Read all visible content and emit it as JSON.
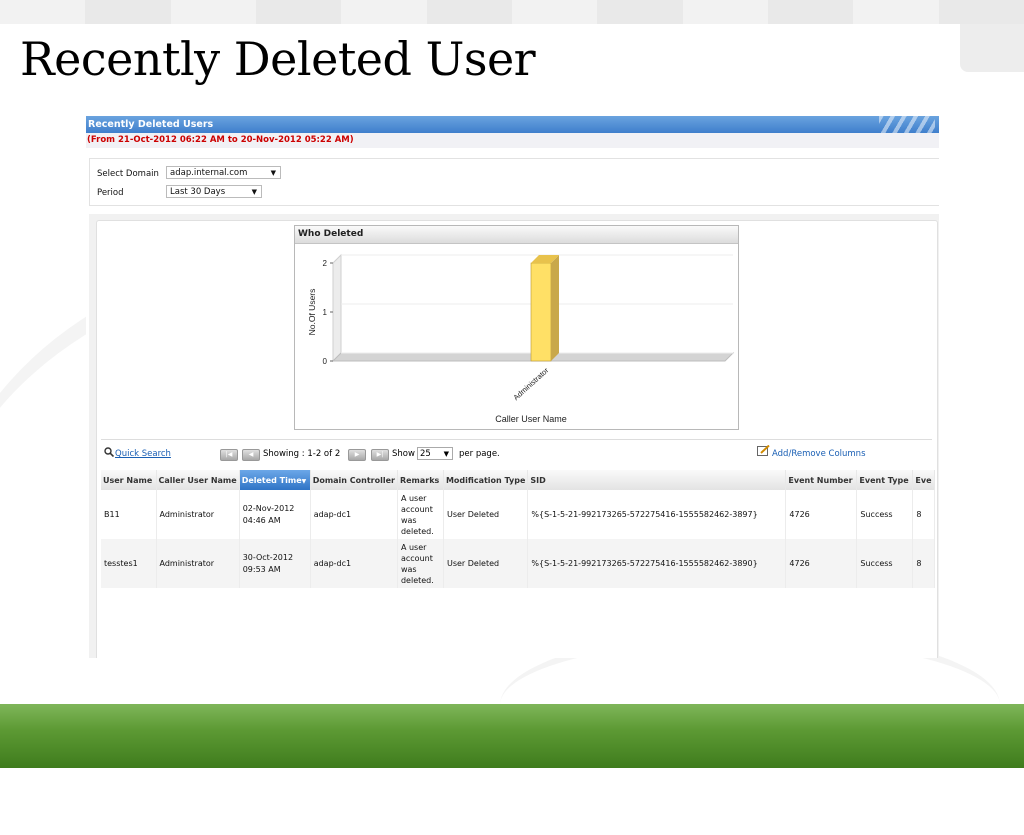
{
  "slide": {
    "title": "Recently Deleted User"
  },
  "report": {
    "header": "Recently Deleted Users",
    "date_range": "(From 21-Oct-2012 06:22 AM to 20-Nov-2012 05:22 AM)"
  },
  "filters": {
    "domain_label": "Select Domain",
    "domain_value": "adap.internal.com",
    "period_label": "Period",
    "period_value": "Last 30 Days"
  },
  "chart_data": {
    "type": "bar",
    "title": "Who Deleted",
    "categories": [
      "Administrator"
    ],
    "values": [
      2
    ],
    "xlabel": "Caller User Name",
    "ylabel": "No.Of Users",
    "ylim": [
      0,
      2
    ],
    "yticks": [
      "0",
      "1",
      "2"
    ],
    "grid": true,
    "colors": {
      "bar": "#ffe066",
      "bar_side": "#c9a84a",
      "bar_top": "#e8c24c",
      "floor": "#d4d4d4"
    }
  },
  "toolbar": {
    "quick_search": "Quick Search",
    "showing": "Showing : 1-2 of 2",
    "show_label": "Show",
    "per_page_value": "25",
    "per_page_label": "per page.",
    "add_remove_columns": "Add/Remove Columns"
  },
  "table": {
    "columns": [
      "User Name",
      "Caller User Name",
      "Deleted Time",
      "Domain Controller",
      "Remarks",
      "Modification Type",
      "SID",
      "Event Number",
      "Event Type",
      "Eve"
    ],
    "rows": [
      {
        "user_name": "B11",
        "caller": "Administrator",
        "deleted_time": "02-Nov-2012 04:46 AM",
        "dc": "adap-dc1",
        "remarks": "A user account was deleted.",
        "mod_type": "User Deleted",
        "sid": "%{S-1-5-21-992173265-572275416-1555582462-3897}",
        "event_number": "4726",
        "event_type": "Success",
        "eve": "8"
      },
      {
        "user_name": "tesstes1",
        "caller": "Administrator",
        "deleted_time": "30-Oct-2012 09:53 AM",
        "dc": "adap-dc1",
        "remarks": "A user account was deleted.",
        "mod_type": "User Deleted",
        "sid": "%{S-1-5-21-992173265-572275416-1555582462-3890}",
        "event_number": "4726",
        "event_type": "Success",
        "eve": "8"
      }
    ]
  }
}
